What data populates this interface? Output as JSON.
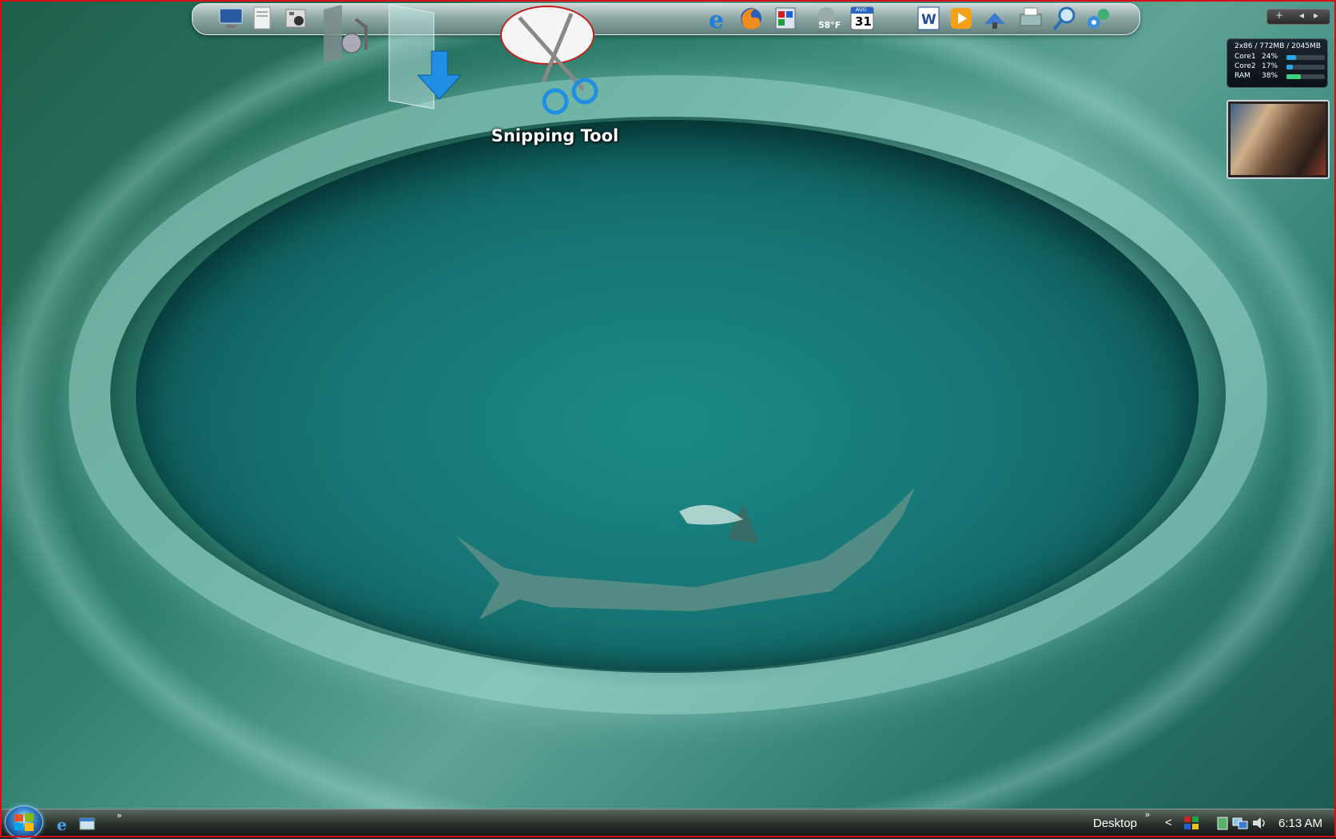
{
  "desktop": {
    "wallpaper": "shark-pool-wallpaper",
    "icons": [
      {
        "name": "music-folder-icon"
      },
      {
        "name": "downloads-folder-icon"
      },
      {
        "name": "snipping-tool-icon",
        "label": "Snipping Tool"
      }
    ]
  },
  "dock": {
    "items": [
      "my-computer-icon",
      "documents-icon",
      "pictures-icon",
      "internet-explorer-icon",
      "firefox-icon",
      "control-panel-icon",
      "weather-icon",
      "calendar-icon",
      "word-icon",
      "media-player-icon",
      "network-icon",
      "printer-icon",
      "search-icon",
      "settings-icon"
    ],
    "weather_text": "58°F",
    "calendar_month": "AUG",
    "calendar_day": "31"
  },
  "gadgets": {
    "meter": {
      "title": "2x86 / 772MB / 2045MB",
      "rows": [
        {
          "label": "Core1",
          "value": "24%",
          "fraction": 0.24,
          "color": "#2aa6e8"
        },
        {
          "label": "Core2",
          "value": "17%",
          "fraction": 0.17,
          "color": "#2aa6e8"
        },
        {
          "label": "RAM",
          "value": "38%",
          "fraction": 0.38,
          "color": "#3fd07a"
        }
      ]
    },
    "plus_label": "+",
    "prev_label": "◂",
    "next_label": "▸"
  },
  "taskbar": {
    "quicklaunch_more": "»",
    "desktop_label": "Desktop",
    "desktop_more": "»",
    "tray_expand": "<",
    "clock": "6:13 AM"
  }
}
